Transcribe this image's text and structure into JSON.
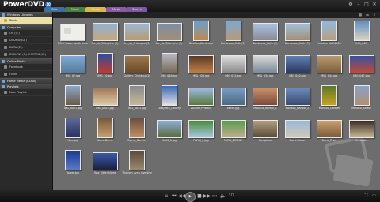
{
  "app": {
    "name": "PowerDVD",
    "badge": "10"
  },
  "tabs": [
    {
      "label": "Disc",
      "color": "#3d6f9c"
    },
    {
      "label": "Movie",
      "color": "#4b7d3d"
    },
    {
      "label": "Photo",
      "color": "#d8b84a"
    },
    {
      "label": "Music",
      "color": "#8a5aa5"
    },
    {
      "label": "Search",
      "color": "#7a5aa0"
    }
  ],
  "window_controls": [
    "minimize-icon",
    "maximize-icon",
    "close-icon"
  ],
  "sidebar": {
    "sections": [
      {
        "label": "Windows Libraries",
        "items": [
          "Photo"
        ]
      },
      {
        "label": "Computer",
        "items": [
          "OS (C:)",
          "DVDRW (D:)",
          "DATA (E:)",
          "DVD-RW (F:) PHOTOS (G:)"
        ]
      },
      {
        "label": "Online Media",
        "items": [
          "Facebook",
          "Flickr"
        ]
      },
      {
        "label": "Home Media (DLNA)",
        "items": []
      },
      {
        "label": "Playlists",
        "items": [
          "New Playlist"
        ]
      }
    ],
    "selected": "Photo"
  },
  "photos": [
    {
      "label": "Eiffel Tower south view",
      "kind": "folder",
      "c1": "#eeeeea",
      "c2": "#cfcfc8"
    },
    {
      "label": "Arc_de_Triomphe (1)",
      "kind": "land",
      "c1": "#8fb3d6",
      "c2": "#c8a77a"
    },
    {
      "label": "Arc_de_Triomphe (2)",
      "kind": "land",
      "c1": "#9ab8d4",
      "c2": "#b99b70"
    },
    {
      "label": "Arc_de_Triomphe (3)",
      "kind": "land",
      "c1": "#7d8ea0",
      "c2": "#a08f78"
    },
    {
      "label": "Basilica_Bordeaux",
      "kind": "port",
      "c1": "#6a9fd0",
      "c2": "#c0884f"
    },
    {
      "label": "Bordeaux_Cath (1)",
      "kind": "port",
      "c1": "#7fa8d2",
      "c2": "#b89a74"
    },
    {
      "label": "Bordeaux_Cath (2)",
      "kind": "land",
      "c1": "#a8c2e0",
      "c2": "#8a8a95"
    },
    {
      "label": "Bordeaux_Cath (3)",
      "kind": "land",
      "c1": "#9fbfdf",
      "c2": "#a48e70"
    },
    {
      "label": "Fountain MARBLE...",
      "kind": "port",
      "c1": "#8fb9e0",
      "c2": "#b9a07c"
    },
    {
      "label": "IMG_003",
      "kind": "port",
      "c1": "#5f8fc8",
      "c2": "#dcd4c0"
    },
    {
      "label": "IMG_07.jpg",
      "kind": "land",
      "c1": "#7ea9d8",
      "c2": "#5a7a9a"
    },
    {
      "label": "IMG_10.jpg",
      "kind": "port",
      "c1": "#2a4fa0",
      "c2": "#c43a2a"
    },
    {
      "label": "Gallery_Chateau (1)",
      "kind": "land",
      "c1": "#9a7a50",
      "c2": "#6a4a2a"
    },
    {
      "label": "IMG_018.jpg",
      "kind": "port",
      "c1": "#b8b8c0",
      "c2": "#7a6a58"
    },
    {
      "label": "IMG_025.jpg",
      "kind": "land",
      "c1": "#5a3a2a",
      "c2": "#c08048"
    },
    {
      "label": "IMG_031.jpg",
      "kind": "land",
      "c1": "#dcdcdc",
      "c2": "#8a8a8a"
    },
    {
      "label": "IMG_034.jpg",
      "kind": "land",
      "c1": "#d8d8d8",
      "c2": "#7a8a98"
    },
    {
      "label": "IMG_040.jpg",
      "kind": "land",
      "c1": "#6080b0",
      "c2": "#2a3a60"
    },
    {
      "label": "IMG_044.jpg",
      "kind": "land",
      "c1": "#b89a70",
      "c2": "#7a6040"
    },
    {
      "label": "IMG_047.jpg",
      "kind": "land",
      "c1": "#3a50a0",
      "c2": "#c04a38"
    },
    {
      "label": "IMG_0021.jpg",
      "kind": "port",
      "c1": "#8aa8c8",
      "c2": "#6a5a48"
    },
    {
      "label": "IMG_0025.jpg",
      "kind": "land",
      "c1": "#a07a58",
      "c2": "#e0c8a8"
    },
    {
      "label": "IMG_0031.jpg",
      "kind": "port",
      "c1": "#8a8a8a",
      "c2": "#c8b89a"
    },
    {
      "label": "Lafayette_Gallery",
      "kind": "port",
      "c1": "#3a6ab8",
      "c2": "#e0e0e0"
    },
    {
      "label": "Louvre_Pyramid",
      "kind": "land",
      "c1": "#9ab8e0",
      "c2": "#5a7a3a"
    },
    {
      "label": "Moret.jpg",
      "kind": "land",
      "c1": "#7a9ac0",
      "c2": "#4a6a80"
    },
    {
      "label": "Monaco_Harbor_1",
      "kind": "land",
      "c1": "#c89068",
      "c2": "#7a4a3a"
    },
    {
      "label": "Monaco_Harbor_2",
      "kind": "land",
      "c1": "#6a8ab8",
      "c2": "#3a4a70"
    },
    {
      "label": "Monaco_Garden",
      "kind": "port",
      "c1": "#5a7a2a",
      "c2": "#c8a020"
    },
    {
      "label": "Monaco_Street",
      "kind": "port",
      "c1": "#8aa0c8",
      "c2": "#b09070"
    },
    {
      "label": "Nice.jpg",
      "kind": "port",
      "c1": "#5a6a9a",
      "c2": "#2a3060"
    },
    {
      "label": "Notre-Dame",
      "kind": "port",
      "c1": "#7a5a3a",
      "c2": "#c8a070"
    },
    {
      "label": "Opera_Garnier",
      "kind": "port",
      "c1": "#6a5040",
      "c2": "#c09060"
    },
    {
      "label": "PARIS_1.jpg",
      "kind": "land",
      "c1": "#8ab0d8",
      "c2": "#5a6a3a"
    },
    {
      "label": "PARIS_2.jpg",
      "kind": "land",
      "c1": "#4a8a3a",
      "c2": "#a8c8e0"
    },
    {
      "label": "PARIS_BRIDGE",
      "kind": "land",
      "c1": "#5a9a50",
      "c2": "#c0b090"
    },
    {
      "label": "Pompidou",
      "kind": "land",
      "c1": "#b0a080",
      "c2": "#5a4a3a"
    },
    {
      "label": "Sacre-Coeur",
      "kind": "land",
      "c1": "#9ab8d8",
      "c2": "#d0c8b8"
    },
    {
      "label": "Seine_River",
      "kind": "land",
      "c1": "#c8a070",
      "c2": "#7a5a3a"
    },
    {
      "label": "Versailles",
      "kind": "land",
      "c1": "#3a2a20",
      "c2": "#c8b898"
    },
    {
      "label": "Tower.jpg",
      "kind": "port",
      "c1": "#1a3a90",
      "c2": "#5a7ac8"
    },
    {
      "label": "Tour_Eiffel_Night",
      "kind": "land",
      "c1": "#3a5aa8",
      "c2": "#1a2040"
    },
    {
      "label": "Triumph_Arch_Evening",
      "kind": "port",
      "c1": "#5a4a3a",
      "c2": "#9a8a70"
    }
  ],
  "player_controls": [
    "playlist-icon",
    "prev-icon",
    "rewind-icon",
    "play-icon",
    "stop-icon",
    "forward-icon",
    "next-icon",
    "volume-icon",
    "3d-icon"
  ],
  "corner_controls": [
    "fullscreen-icon",
    "mini-mode-icon"
  ]
}
